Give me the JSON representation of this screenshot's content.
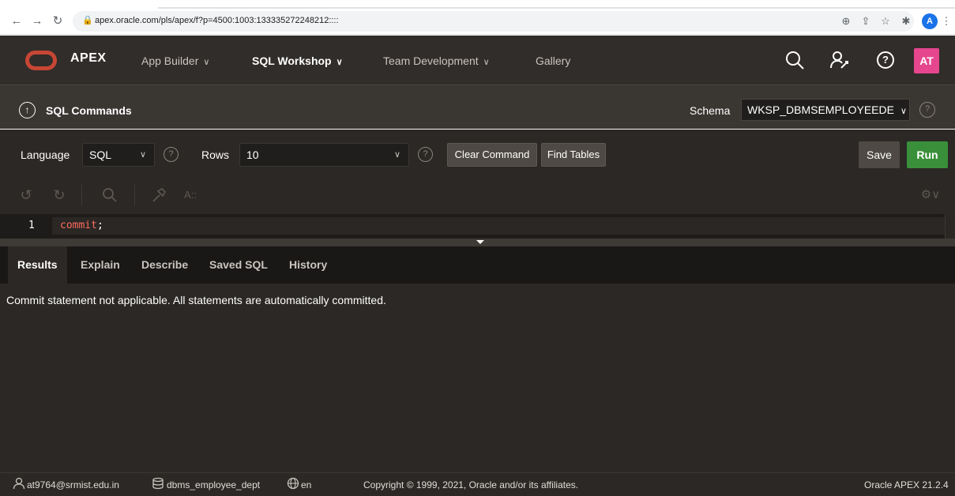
{
  "browser": {
    "url": "apex.oracle.com/pls/apex/f?p=4500:1003:133335272248212::::",
    "profile_initial": "A"
  },
  "header": {
    "brand": "APEX",
    "nav": [
      "App Builder",
      "SQL Workshop",
      "Team Development",
      "Gallery"
    ],
    "avatar": "AT"
  },
  "page": {
    "title": "SQL Commands",
    "schema_label": "Schema",
    "schema_value": "WKSP_DBMSEMPLOYEEDE"
  },
  "toolbar": {
    "language_label": "Language",
    "language_value": "SQL",
    "rows_label": "Rows",
    "rows_value": "10",
    "clear_command": "Clear Command",
    "find_tables": "Find Tables",
    "save": "Save",
    "run": "Run"
  },
  "editor": {
    "line_number": "1",
    "code_keyword": "commit",
    "code_rest": ";"
  },
  "results": {
    "tabs": [
      "Results",
      "Explain",
      "Describe",
      "Saved SQL",
      "History"
    ],
    "active_tab": "Results",
    "message": "Commit statement not applicable. All statements are automatically committed."
  },
  "footer": {
    "user": "at9764@srmist.edu.in",
    "workspace": "dbms_employee_dept",
    "language": "en",
    "copyright": "Copyright © 1999, 2021, Oracle and/or its affiliates.",
    "version": "Oracle APEX 21.2.4"
  }
}
